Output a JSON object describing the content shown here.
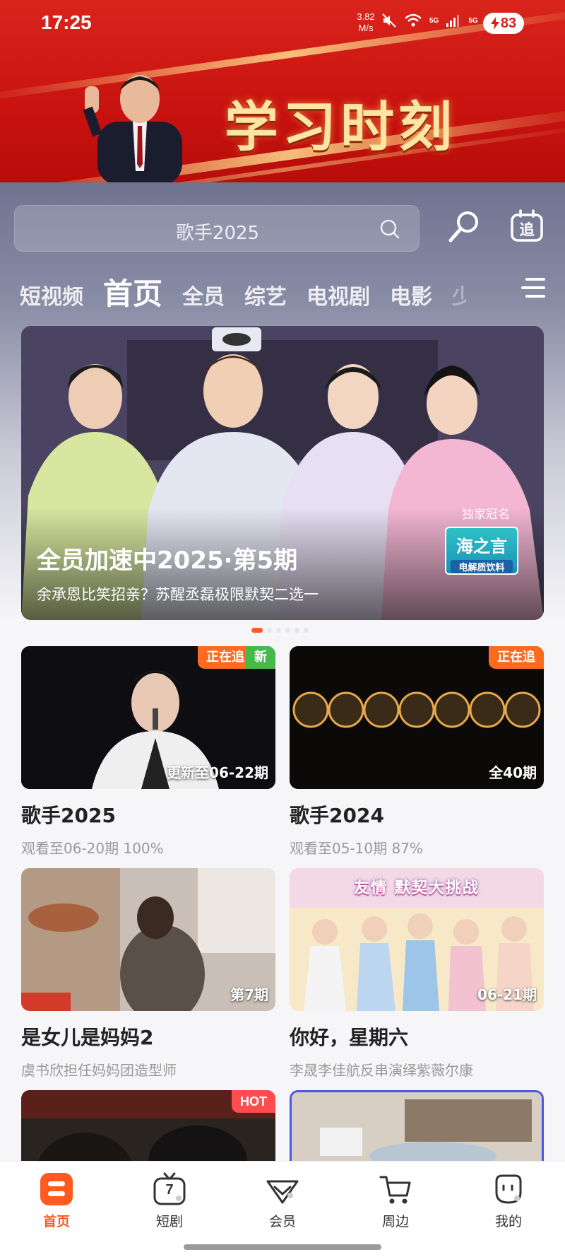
{
  "status_bar": {
    "time": "17:25",
    "net_speed_value": "3.82",
    "net_speed_unit": "M/s",
    "net_label_1": "5G",
    "net_label_2": "5G",
    "battery": "83"
  },
  "banner": {
    "title": "学习时刻"
  },
  "search": {
    "placeholder": "歌手2025"
  },
  "top_icons": {
    "follow_icon_char": "追"
  },
  "tabs": [
    {
      "label": "短视频"
    },
    {
      "label": "首页",
      "active": true
    },
    {
      "label": "全员"
    },
    {
      "label": "综艺"
    },
    {
      "label": "电视剧"
    },
    {
      "label": "电影"
    },
    {
      "label": "少"
    }
  ],
  "hero": {
    "title": "全员加速中2025·第5期",
    "subtitle": "余承恩比笑招亲？苏醒丞磊极限默契二选一",
    "sponsor_label": "独家冠名",
    "sponsor_brand": "海之言",
    "sponsor_product": "电解质饮料",
    "slides": 6,
    "active_slide": 0
  },
  "cards": [
    {
      "title": "歌手2025",
      "subtitle": "观看至06-20期 100%",
      "badge_follow": "正在追",
      "badge_new": "新",
      "overlay": "更新至06-22期"
    },
    {
      "title": "歌手2024",
      "subtitle": "观看至05-10期 87%",
      "badge_follow": "正在追",
      "overlay": "全40期"
    },
    {
      "title": "是女儿是妈妈2",
      "subtitle": "虞书欣担任妈妈团造型师",
      "overlay": "第7期"
    },
    {
      "title": "你好，星期六",
      "subtitle": "李晟李佳航反串演绎紫薇尔康",
      "overlay": "06-21期",
      "banner_text": "友情 默契大挑战"
    },
    {
      "title": "",
      "subtitle": "",
      "badge_hot": "HOT"
    },
    {
      "title": "",
      "subtitle": ""
    }
  ],
  "bottom_nav": [
    {
      "label": "首页",
      "icon": "home-icon",
      "active": true
    },
    {
      "label": "短剧",
      "icon": "tv-icon",
      "badge": "7"
    },
    {
      "label": "会员",
      "icon": "vip-icon"
    },
    {
      "label": "周边",
      "icon": "cart-icon"
    },
    {
      "label": "我的",
      "icon": "profile-icon"
    }
  ],
  "colors": {
    "accent": "#ff5a1f",
    "follow_badge": "#ff6a21",
    "new_badge": "#47b94a",
    "hot_badge": "#ff4d4f",
    "banner_red": "#d9251c"
  }
}
